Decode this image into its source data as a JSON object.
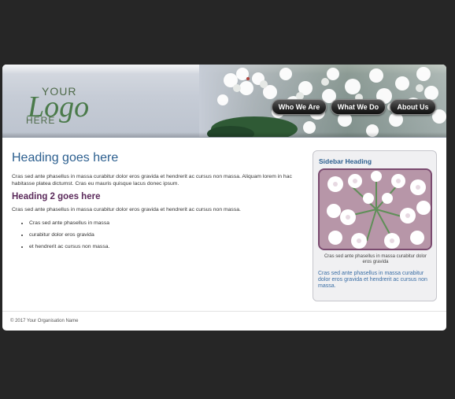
{
  "logo": {
    "top": "YOUR",
    "main": "Logo",
    "bottom": "HERE"
  },
  "nav": {
    "items": [
      {
        "label": "Who We Are"
      },
      {
        "label": "What We Do"
      },
      {
        "label": "About Us"
      }
    ]
  },
  "main": {
    "heading": "Heading goes here",
    "intro": "Cras sed ante phasellus in massa curabitur dolor eros gravida et hendrerit ac cursus non massa. Aliquam lorem in hac habitasse platea dictumst. Cras eu mauris quisque lacus donec ipsum.",
    "heading2": "Heading 2 goes here",
    "para2": "Cras sed ante phasellus in massa curabitur dolor eros gravida et hendrerit ac cursus non massa.",
    "list": [
      "Cras sed ante phasellus in massa",
      "curabitur dolor eros gravida",
      "et hendrerit ac cursus non massa."
    ]
  },
  "sidebar": {
    "heading": "Sidebar Heading",
    "caption": "Cras sed ante phasellus in massa curabitur dolor eros gravida",
    "text": "Cras sed ante phasellus in massa curabitur dolor eros gravida et hendrerit ac cursus non massa."
  },
  "footer": {
    "text": "© 2017 Your Organisation Name"
  },
  "colors": {
    "background": "#262626",
    "heading": "#2c5f8f",
    "heading2": "#5b2a5b",
    "sidebar_link": "#3a6ea5"
  }
}
